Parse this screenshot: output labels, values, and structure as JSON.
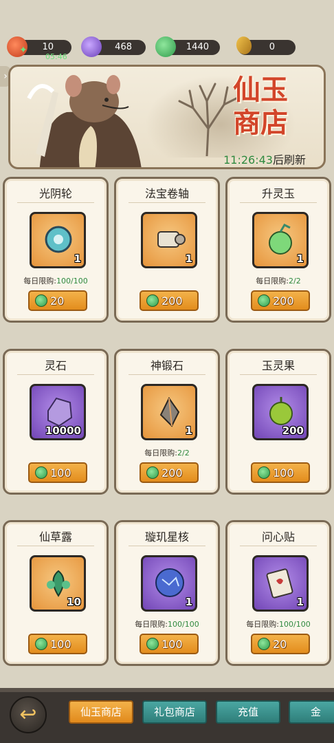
{
  "currencies": [
    {
      "id": "stamina",
      "value": "10",
      "sub": "05:46"
    },
    {
      "id": "crystal",
      "value": "468"
    },
    {
      "id": "jade",
      "value": "1440"
    },
    {
      "id": "gold",
      "value": "0"
    }
  ],
  "banner": {
    "title_line1": "仙玉",
    "title_line2": "商店",
    "timer": "11:26:43",
    "refresh_text": "后刷新"
  },
  "items": [
    {
      "name": "光阴轮",
      "count": "1",
      "limit_label": "每日限购:",
      "limit": "100/100",
      "price": "20",
      "rarity": "orange"
    },
    {
      "name": "法宝卷轴",
      "count": "1",
      "limit_label": "",
      "limit": "",
      "price": "200",
      "rarity": "orange"
    },
    {
      "name": "升灵玉",
      "count": "1",
      "limit_label": "每日限购:",
      "limit": "2/2",
      "price": "200",
      "rarity": "orange"
    },
    {
      "name": "灵石",
      "count": "10000",
      "limit_label": "",
      "limit": "",
      "price": "100",
      "rarity": "purple"
    },
    {
      "name": "神锻石",
      "count": "1",
      "limit_label": "每日限购:",
      "limit": "2/2",
      "price": "200",
      "rarity": "orange"
    },
    {
      "name": "玉灵果",
      "count": "200",
      "limit_label": "",
      "limit": "",
      "price": "100",
      "rarity": "purple"
    },
    {
      "name": "仙草露",
      "count": "10",
      "limit_label": "",
      "limit": "",
      "price": "100",
      "rarity": "orange"
    },
    {
      "name": "璇玑星核",
      "count": "1",
      "limit_label": "每日限购:",
      "limit": "100/100",
      "price": "100",
      "rarity": "purple"
    },
    {
      "name": "问心贴",
      "count": "1",
      "limit_label": "每日限购:",
      "limit": "100/100",
      "price": "20",
      "rarity": "purple"
    }
  ],
  "nav": {
    "tabs": [
      "仙玉商店",
      "礼包商店",
      "充值",
      "金"
    ]
  },
  "colors": {
    "accent_orange": "#e38d1d",
    "teal_tab": "#2f7e7a",
    "limit_green": "#2f8a3f",
    "banner_title": "#d2452a"
  }
}
